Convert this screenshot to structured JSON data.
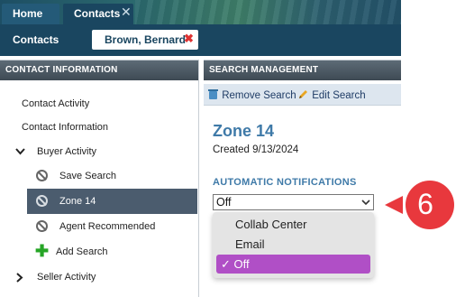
{
  "tabs": [
    {
      "label": "Home"
    },
    {
      "label": "Contacts",
      "close": "✕"
    }
  ],
  "subnav": {
    "label": "Contacts",
    "chip": {
      "label": "Brown, Bernard",
      "close": "✖"
    }
  },
  "left_panel": {
    "header": "CONTACT INFORMATION",
    "items": [
      {
        "label": "Contact Activity"
      },
      {
        "label": "Contact Information"
      },
      {
        "label": "Buyer Activity",
        "expanded": true
      },
      {
        "label": "Save Search",
        "icon": "ban-icon"
      },
      {
        "label": "Zone 14",
        "icon": "ban-icon",
        "selected": true
      },
      {
        "label": "Agent Recommended",
        "icon": "ban-icon"
      },
      {
        "label": "Add Search",
        "icon": "plus-icon"
      },
      {
        "label": "Seller Activity",
        "expanded": false
      }
    ]
  },
  "right_panel": {
    "header": "SEARCH MANAGEMENT",
    "toolbar": {
      "remove": "Remove Search",
      "edit": "Edit Search"
    },
    "title": "Zone 14",
    "created": "Created 9/13/2024",
    "notifications_label": "AUTOMATIC NOTIFICATIONS",
    "select_value": "Off",
    "options": [
      {
        "label": "Collab Center"
      },
      {
        "label": "Email"
      },
      {
        "label": "✓ Off",
        "selected": true
      }
    ]
  },
  "callout": {
    "label": "6"
  },
  "colors": {
    "accent": "#3f7aa8",
    "nav": "#1a4660",
    "selected_row": "#4b5c6e",
    "option_highlight": "#b04fc6",
    "callout": "#e8383d"
  }
}
